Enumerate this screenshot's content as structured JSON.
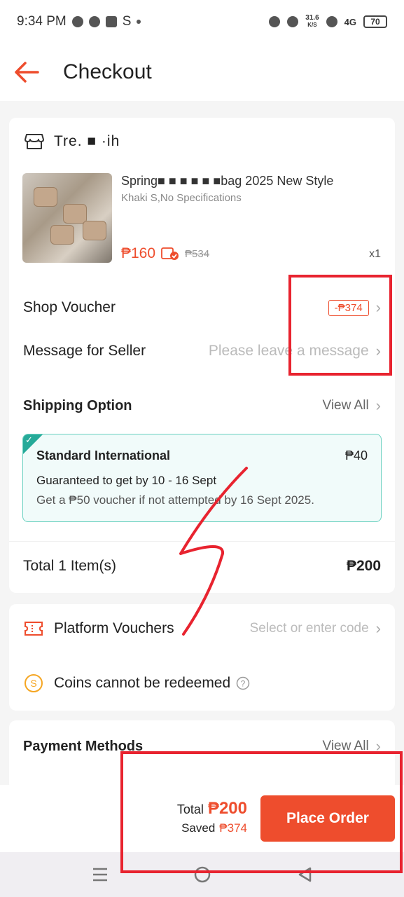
{
  "status_bar": {
    "time": "9:34 PM",
    "carrier_letter": "S",
    "net_speed_value": "31.6",
    "net_speed_unit": "K/S",
    "signal": "4G",
    "battery": "70"
  },
  "header": {
    "title": "Checkout"
  },
  "shop": {
    "name": "Tre. ■ ·ih",
    "product": {
      "title": "Spring■ ■ ■ ■ ■ ■bag 2025 New Style",
      "variant": "Khaki S,No Specifications",
      "price": "₱160",
      "original_price": "₱534",
      "quantity": "x1"
    },
    "shop_voucher": {
      "label": "Shop Voucher",
      "value": "-₱374"
    },
    "message": {
      "label": "Message for Seller",
      "placeholder": "Please leave a message"
    },
    "shipping": {
      "label": "Shipping Option",
      "view_all": "View All",
      "method": "Standard International",
      "price": "₱40",
      "guarantee": "Guaranteed to get by 10 - 16 Sept",
      "note": "Get a ₱50 voucher if not attempted by 16 Sept 2025."
    },
    "total": {
      "label": "Total 1 Item(s)",
      "value": "₱200"
    }
  },
  "platform": {
    "vouchers_label": "Platform Vouchers",
    "vouchers_placeholder": "Select or enter code",
    "coins_label": "Coins cannot be redeemed"
  },
  "payment": {
    "label": "Payment Methods",
    "view_all": "View All"
  },
  "bottom": {
    "total_label": "Total",
    "total_value": "₱200",
    "saved_label": "Saved",
    "saved_value": "₱374",
    "place_order": "Place Order"
  },
  "colors": {
    "accent": "#ee4d2d",
    "shipping_border": "#6ad1c0",
    "annotation_red": "#e8232f"
  }
}
